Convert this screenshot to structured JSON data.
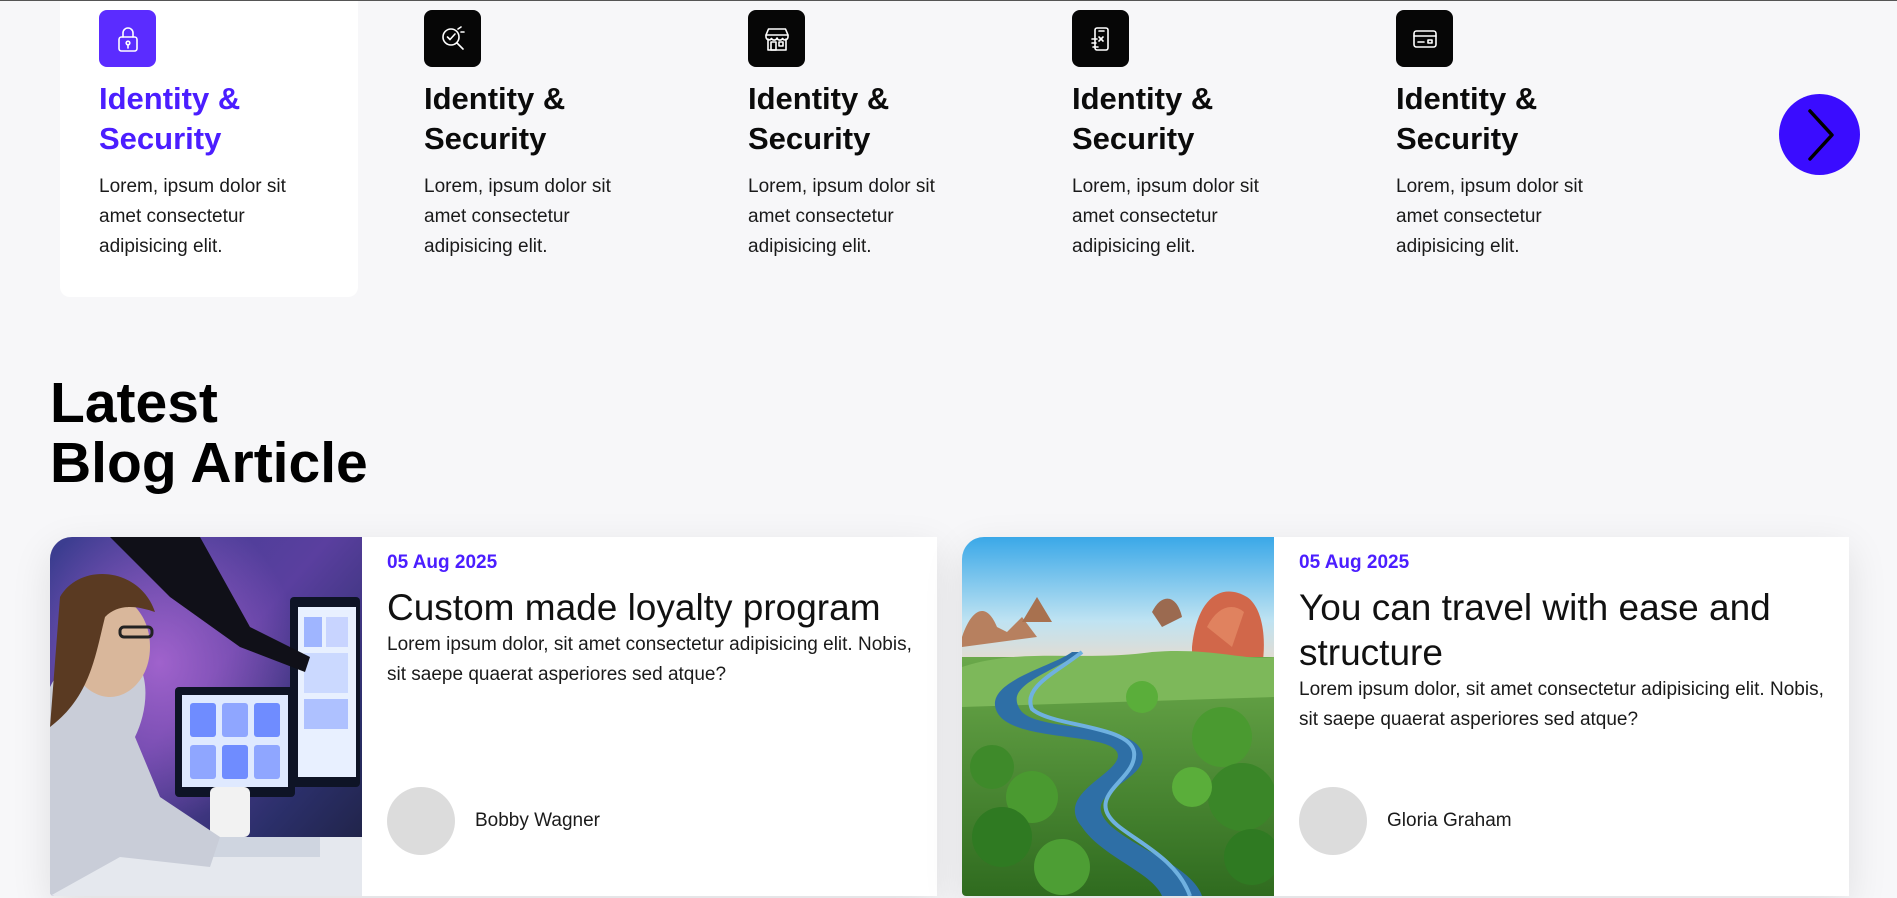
{
  "features": {
    "items": [
      {
        "icon": "lock-icon",
        "title": "Identity & Security",
        "description": "Lorem, ipsum dolor sit amet consectetur adipisicing elit.",
        "active": true
      },
      {
        "icon": "search-check-icon",
        "title": "Identity & Security",
        "description": "Lorem, ipsum dolor sit amet consectetur adipisicing elit.",
        "active": false
      },
      {
        "icon": "store-icon",
        "title": "Identity & Security",
        "description": "Lorem, ipsum dolor sit amet consectetur adipisicing elit.",
        "active": false
      },
      {
        "icon": "mobile-payment-icon",
        "title": "Identity & Security",
        "description": "Lorem, ipsum dolor sit amet consectetur adipisicing elit.",
        "active": false
      },
      {
        "icon": "credit-card-icon",
        "title": "Identity & Security",
        "description": "Lorem, ipsum dolor sit amet consectetur adipisicing elit.",
        "active": false
      }
    ],
    "next_icon": "chevron-right-icon"
  },
  "blog": {
    "heading_line1": "Latest",
    "heading_line2": "Blog Article",
    "cards": [
      {
        "image": "woman-at-computer-photo",
        "date": "05 Aug 2025",
        "title": "Custom made loyalty program",
        "excerpt": "Lorem ipsum dolor, sit amet consectetur adipisicing elit. Nobis, sit saepe quaerat asperiores sed atque?",
        "author": "Bobby Wagner"
      },
      {
        "image": "river-landscape-photo",
        "date": "05 Aug 2025",
        "title": "You can travel with ease and structure",
        "excerpt": "Lorem ipsum dolor, sit amet consectetur adipisicing elit. Nobis, sit saepe quaerat asperiores sed atque?",
        "author": "Gloria Graham"
      }
    ]
  },
  "colors": {
    "accent": "#4b1eff",
    "accent_button": "#3a0cff",
    "icon_bg": "#060606",
    "page_bg": "#f7f7f9"
  }
}
